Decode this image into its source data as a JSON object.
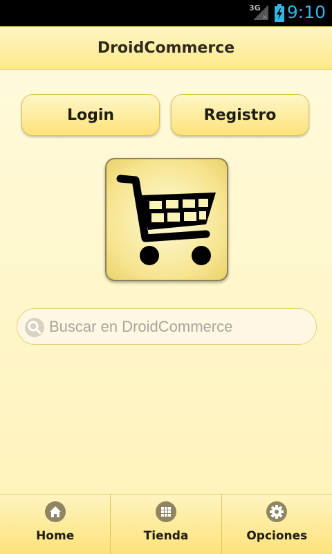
{
  "status_bar": {
    "network": "3G",
    "time": "9:10",
    "signal_icon": "signal-icon",
    "battery_icon": "battery-charging-icon",
    "time_color": "#33b5e5"
  },
  "app": {
    "title": "DroidCommerce"
  },
  "actions": {
    "login_label": "Login",
    "register_label": "Registro"
  },
  "logo": {
    "icon": "shopping-cart-icon"
  },
  "search": {
    "placeholder": "Buscar en DroidCommerce",
    "value": "",
    "icon": "search-icon"
  },
  "bottom_nav": {
    "tabs": [
      {
        "label": "Home",
        "icon": "home-icon"
      },
      {
        "label": "Tienda",
        "icon": "grid-icon"
      },
      {
        "label": "Opciones",
        "icon": "gear-icon"
      }
    ]
  },
  "colors": {
    "accent": "#fde27a",
    "background": "#fff6cc",
    "status_accent": "#33b5e5"
  }
}
